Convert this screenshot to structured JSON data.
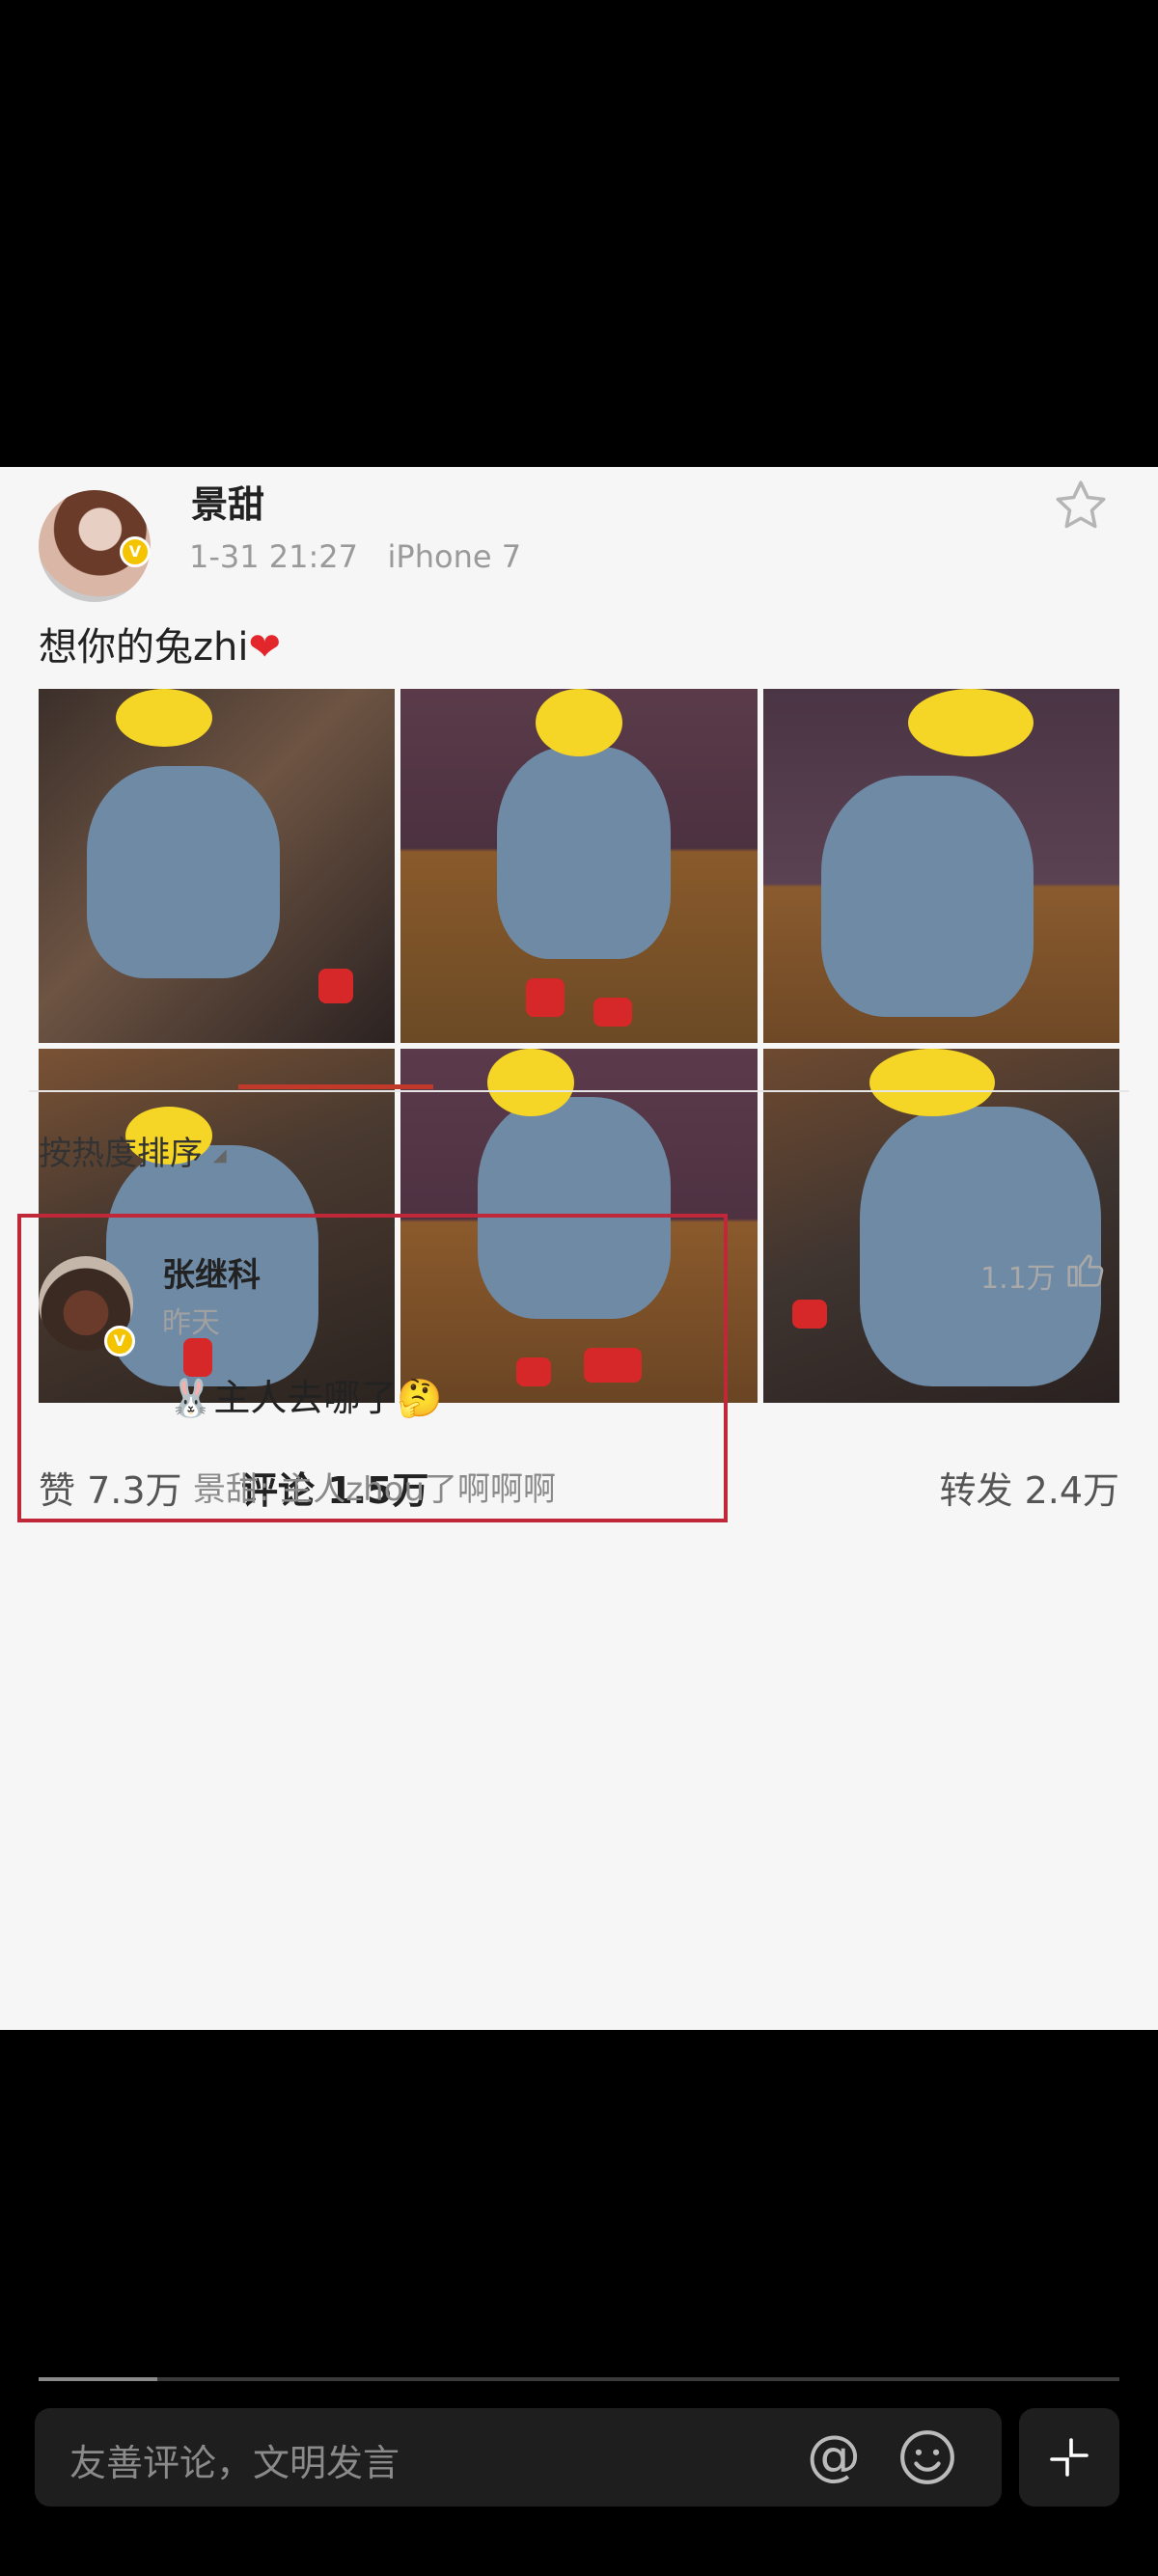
{
  "post": {
    "author": "景甜",
    "timestamp": "1-31 21:27",
    "device": "iPhone 7",
    "text": "想你的兔zhi",
    "heart": "❤"
  },
  "stats": {
    "likes": "赞 7.3万",
    "comments": "评论 1.5万",
    "reposts": "转发 2.4万"
  },
  "sort_label": "按热度排序",
  "comment": {
    "author": "张继科",
    "time": "昨天",
    "text": "主人去哪了",
    "reply": "景甜: 主人zhou了啊啊啊",
    "likes": "1.1万"
  },
  "input": {
    "placeholder": "友善评论，文明发言",
    "at_symbol": "@"
  },
  "video_progress": 0.11,
  "icons": [
    "star-icon",
    "heart-icon",
    "verified-badge-icon",
    "thumbs-up-icon",
    "at-icon",
    "emoji-icon",
    "expand-icon"
  ],
  "colors": {
    "accent": "#c0392b",
    "highlight_box": "#c0283a",
    "verified": "#f5c400"
  }
}
